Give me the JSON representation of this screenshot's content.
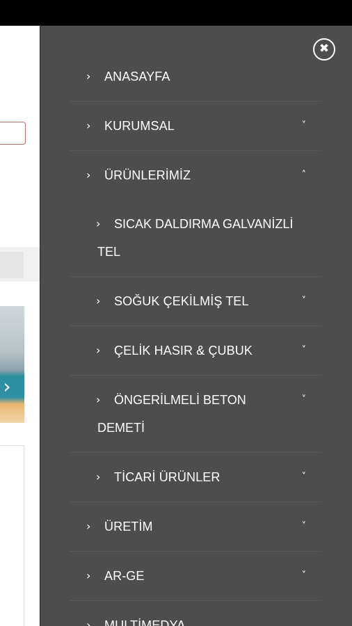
{
  "close": {
    "icon": "close-icon",
    "glyph": "✖"
  },
  "menu": {
    "items": [
      {
        "label": "ANASAYFA",
        "icon": "chevron-right-icon",
        "toggle": ""
      },
      {
        "label": "KURUMSAL",
        "icon": "chevron-right-icon",
        "toggle": "˅"
      },
      {
        "label": "ÜRÜNLERİMİZ",
        "icon": "chevron-right-icon",
        "toggle": "˄"
      },
      {
        "line1": "SICAK DALDIRMA GALVANİZLİ",
        "line2": "TEL",
        "icon": "chevron-right-icon"
      },
      {
        "label": "SOĞUK ÇEKİLMİŞ TEL",
        "icon": "chevron-right-icon",
        "toggle": "˅"
      },
      {
        "label": "ÇELİK HASIR & ÇUBUK",
        "icon": "chevron-right-icon",
        "toggle": "˅"
      },
      {
        "line1": "ÖNGERİLMELİ BETON",
        "line2": "DEMETİ",
        "icon": "chevron-right-icon",
        "toggle": "˅"
      },
      {
        "label": "TİCARİ ÜRÜNLER",
        "icon": "chevron-right-icon",
        "toggle": "˅"
      },
      {
        "label": "ÜRETİM",
        "icon": "chevron-right-icon",
        "toggle": "˅"
      },
      {
        "label": "AR-GE",
        "icon": "chevron-right-icon",
        "toggle": "˅"
      },
      {
        "label": "MULTİMEDYA",
        "icon": "chevron-right-icon",
        "toggle": ""
      }
    ],
    "chevron": "›"
  },
  "page": {
    "banner_arrow": "›"
  },
  "colors": {
    "panel_bg": "#4d4d4d",
    "divider": "#585858",
    "text": "#ffffff",
    "top_bar": "#000000"
  }
}
